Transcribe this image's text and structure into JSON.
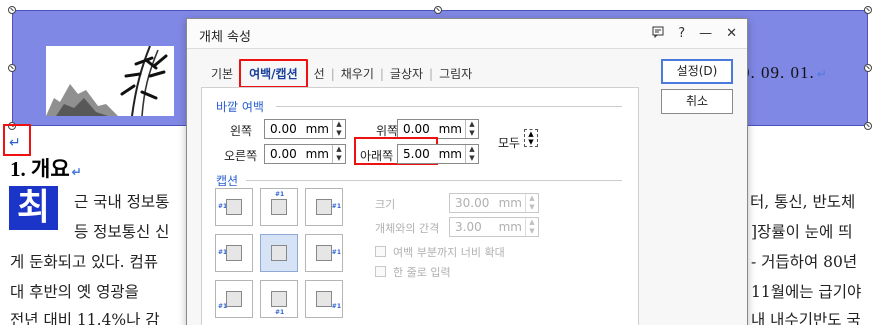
{
  "document": {
    "date_text": "0. 09. 01.",
    "para_mark": "↵",
    "heading": "1. 개요",
    "dropcap": "최",
    "lines": [
      {
        "text": "근 국내 정보통"
      },
      {
        "text": "등 정보통신 신"
      },
      {
        "text": "게 둔화되고 있다. 컴퓨"
      },
      {
        "text": "대 후반의 옛 영광을"
      },
      {
        "text": "전년 대비 11.4%나 감"
      },
      {
        "text": "터, 통신, 반도체"
      },
      {
        "text": "]장률이 눈에 띄"
      },
      {
        "text": "- 거듭하여 80년"
      },
      {
        "text": "11월에는 급기야"
      },
      {
        "text": "내 내수기반도 국"
      }
    ]
  },
  "dialog": {
    "title": "개체 속성",
    "icons": {
      "help_panel": "message-icon",
      "help": "?",
      "minimize": "—",
      "close": "✕"
    },
    "tabs": [
      {
        "label": "기본"
      },
      {
        "label": "여백/캡션",
        "active": true
      },
      {
        "label": "선"
      },
      {
        "label": "채우기"
      },
      {
        "label": "글상자"
      },
      {
        "label": "그림자"
      }
    ],
    "outer_margin": {
      "section_label": "바깥 여백",
      "left": {
        "label": "왼쪽",
        "value": "0.00",
        "unit": "mm"
      },
      "top": {
        "label": "위쪽",
        "value": "0.00",
        "unit": "mm"
      },
      "right": {
        "label": "오른쪽",
        "value": "0.00",
        "unit": "mm"
      },
      "bottom": {
        "label": "아래쪽",
        "value": "5.00",
        "unit": "mm"
      },
      "all_label": "모두"
    },
    "caption": {
      "section_label": "캡션",
      "cell_number": "#1",
      "size": {
        "label": "크기",
        "value": "30.00",
        "unit": "mm"
      },
      "gap": {
        "label": "개체와의 간격",
        "value": "3.00",
        "unit": "mm"
      },
      "expand_label": "여백 부분까지 너비 확대",
      "single_line_label": "한 줄로 입력"
    },
    "buttons": {
      "ok": "설정(D)",
      "cancel": "취소"
    }
  }
}
